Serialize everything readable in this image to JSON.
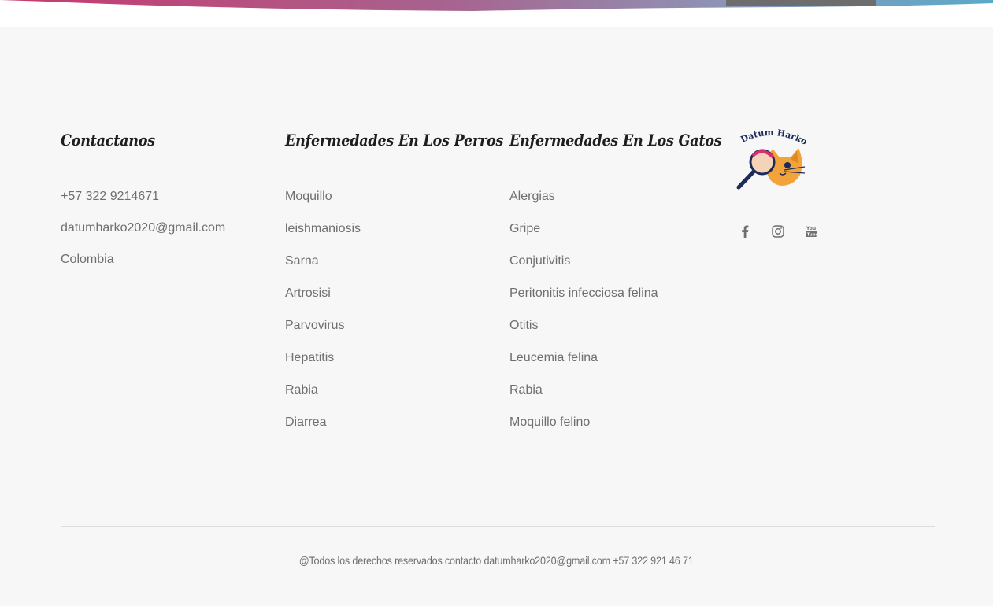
{
  "contact": {
    "heading": "Contactanos",
    "items": [
      "+57 322 9214671",
      "datumharko2020@gmail.com",
      "Colombia"
    ]
  },
  "dogs": {
    "heading": "Enfermedades En Los Perros",
    "items": [
      "Moquillo",
      "leishmaniosis",
      "Sarna",
      "Artrosisi",
      "Parvovirus",
      "Hepatitis",
      "Rabia",
      "Diarrea"
    ]
  },
  "cats": {
    "heading": "Enfermedades En Los Gatos",
    "items": [
      "Alergias",
      "Gripe",
      "Conjutivitis",
      "Peritonitis infecciosa felina",
      "Otitis",
      "Leucemia felina",
      "Rabia",
      "Moquillo felino"
    ]
  },
  "brand": {
    "logo_text": "Datum Harko",
    "social": [
      "facebook-icon",
      "instagram-icon",
      "youtube-icon"
    ]
  },
  "copyright": "@Todos los derechos reservados contacto datumharko2020@gmail.com +57 322 921 46 71",
  "colors": {
    "background": "#f7f7f7",
    "text": "#6f6f6f",
    "heading": "#1e1e1e",
    "logo_orange": "#f2a33a",
    "logo_navy": "#1c2a5c",
    "logo_pink": "#d4326e"
  }
}
